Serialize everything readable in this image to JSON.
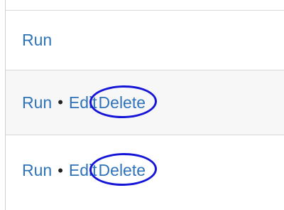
{
  "rows": [
    {
      "run_label": "Run"
    },
    {
      "run_label": "Run",
      "separator": "•",
      "edit_label": "Edit",
      "delete_label": "Delete"
    },
    {
      "run_label": "Run",
      "separator": "•",
      "edit_label": "Edit",
      "delete_label": "Delete"
    }
  ],
  "colors": {
    "link": "#2f73b8",
    "highlight_oval": "#1515d8",
    "alt_row_background": "#f7f7f7"
  }
}
